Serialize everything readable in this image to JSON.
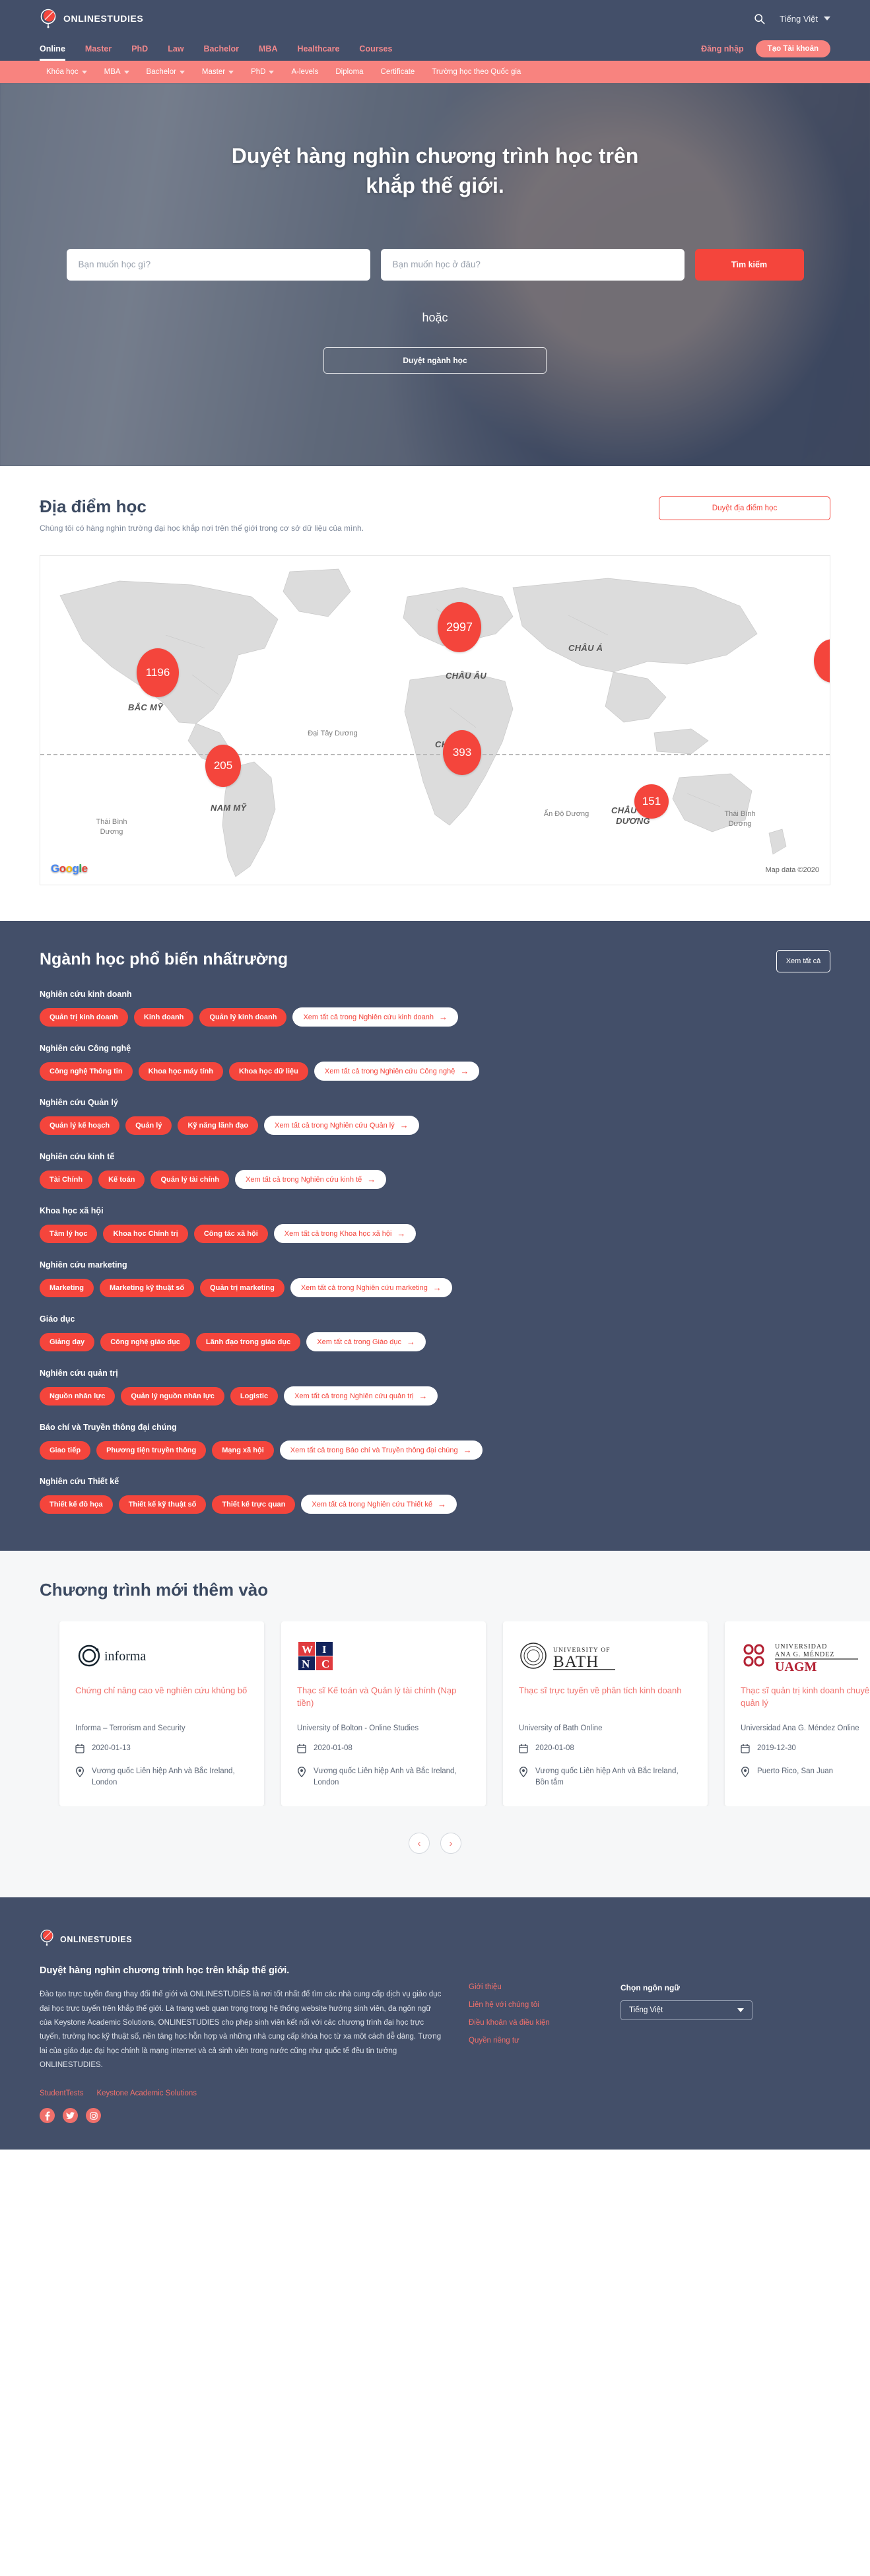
{
  "brand": {
    "name": "ONLINESTUDIES",
    "logo_icon": "globe-logo-icon"
  },
  "header": {
    "search_icon": "search-icon",
    "language": "Tiếng Việt",
    "caret_icon": "chevron-down-icon"
  },
  "nav_primary": {
    "items": [
      {
        "label": "Online",
        "active": true
      },
      {
        "label": "Master",
        "active": false
      },
      {
        "label": "PhD",
        "active": false
      },
      {
        "label": "Law",
        "active": false
      },
      {
        "label": "Bachelor",
        "active": false
      },
      {
        "label": "MBA",
        "active": false
      },
      {
        "label": "Healthcare",
        "active": false
      },
      {
        "label": "Courses",
        "active": false
      }
    ],
    "login_label": "Đăng nhập",
    "signup_label": "Tạo Tài khoản"
  },
  "nav_secondary": {
    "items": [
      {
        "label": "Khóa học",
        "dropdown": true
      },
      {
        "label": "MBA",
        "dropdown": true
      },
      {
        "label": "Bachelor",
        "dropdown": true
      },
      {
        "label": "Master",
        "dropdown": true
      },
      {
        "label": "PhD",
        "dropdown": true
      },
      {
        "label": "A-levels",
        "dropdown": false
      },
      {
        "label": "Diploma",
        "dropdown": false
      },
      {
        "label": "Certificate",
        "dropdown": false
      },
      {
        "label": "Trường học theo Quốc gia",
        "dropdown": false
      }
    ]
  },
  "hero": {
    "title": "Duyệt hàng nghìn chương trình học trên khắp thế giới.",
    "what_placeholder": "Bạn muốn học gì?",
    "what_value": "",
    "where_placeholder": "Bạn muốn học ở đâu?",
    "where_value": "",
    "search_label": "Tìm kiếm",
    "or_label": "hoặc",
    "browse_label": "Duyệt ngành học"
  },
  "locations": {
    "title": "Địa điểm học",
    "subtitle": "Chúng tôi có hàng nghìn trường đại học khắp nơi trên thế giới trong cơ sở dữ liệu của mình.",
    "button_label": "Duyệt địa điểm học",
    "map_credit": "Map data ©2020",
    "map_logo": "Google",
    "markers": [
      {
        "value": "1196",
        "region": "BẮC MỸ"
      },
      {
        "value": "2997",
        "region": "CHÂU ÂU"
      },
      {
        "value": "393",
        "region": "CHÂU PHI"
      },
      {
        "value": "205",
        "region": "NAM MỸ"
      },
      {
        "value": "151",
        "region": "CHÂU ĐẠI DƯƠNG"
      }
    ],
    "continent_labels": [
      "BẮC MỸ",
      "NAM MỸ",
      "CHÂU ÂU",
      "CHÂU Á",
      "CHÂU PHI",
      "CHÂU ĐẠI DƯƠNG"
    ],
    "ocean_labels": [
      "Đại Tây Dương",
      "Thái Bình Dương",
      "Ấn Độ Dương",
      "Thái Bình Dương"
    ]
  },
  "fields": {
    "title": "Ngành học phổ biến nhấtrường",
    "view_all_label": "Xem tất cả",
    "groups": [
      {
        "label": "Nghiên cứu kinh doanh",
        "chips": [
          "Quản trị kinh doanh",
          "Kinh doanh",
          "Quản lý kinh doanh"
        ],
        "all_label": "Xem tất cả trong Nghiên cứu kinh doanh"
      },
      {
        "label": "Nghiên cứu Công nghệ",
        "chips": [
          "Công nghệ Thông tin",
          "Khoa học máy tính",
          "Khoa học dữ liệu"
        ],
        "all_label": "Xem tất cả trong Nghiên cứu Công nghệ"
      },
      {
        "label": "Nghiên cứu Quản lý",
        "chips": [
          "Quản lý kế hoạch",
          "Quản lý",
          "Kỹ năng lãnh đạo"
        ],
        "all_label": "Xem tất cả trong Nghiên cứu Quản lý"
      },
      {
        "label": "Nghiên cứu kinh tế",
        "chips": [
          "Tài Chính",
          "Kế toán",
          "Quản lý tài chính"
        ],
        "all_label": "Xem tất cả trong Nghiên cứu kinh tế"
      },
      {
        "label": "Khoa học xã hội",
        "chips": [
          "Tâm lý học",
          "Khoa học Chính trị",
          "Công tác xã hội"
        ],
        "all_label": "Xem tất cả trong Khoa học xã hội"
      },
      {
        "label": "Nghiên cứu marketing",
        "chips": [
          "Marketing",
          "Marketing kỹ thuật số",
          "Quản trị marketing"
        ],
        "all_label": "Xem tất cả trong Nghiên cứu marketing"
      },
      {
        "label": "Giáo dục",
        "chips": [
          "Giảng dạy",
          "Công nghệ giáo dục",
          "Lãnh đạo trong giáo dục"
        ],
        "all_label": "Xem tất cả trong Giáo dục"
      },
      {
        "label": "Nghiên cứu quản trị",
        "chips": [
          "Nguồn nhân lực",
          "Quản lý nguồn nhân lực",
          "Logistic"
        ],
        "all_label": "Xem tất cả trong Nghiên cứu quản trị"
      },
      {
        "label": "Báo chí và Truyền thông đại chúng",
        "chips": [
          "Giao tiếp",
          "Phương tiện truyền thông",
          "Mạng xã hội"
        ],
        "all_label": "Xem tất cả trong Báo chí và Truyền thông đại chúng"
      },
      {
        "label": "Nghiên cứu Thiết kế",
        "chips": [
          "Thiết kế đồ họa",
          "Thiết kế kỹ thuật số",
          "Thiết kế trực quan"
        ],
        "all_label": "Xem tất cả trong Nghiên cứu Thiết kế"
      }
    ]
  },
  "programs": {
    "title": "Chương trình mới thêm vào",
    "date_icon": "calendar-icon",
    "location_icon": "map-pin-icon",
    "prev_icon": "chevron-left-icon",
    "next_icon": "chevron-right-icon",
    "cards": [
      {
        "logo_text": "informa",
        "logo_kind": "informa-logo",
        "title": "Chứng chỉ nâng cao về nghiên cứu khủng bố",
        "school": "Informa – Terrorism and Security",
        "date": "2020-01-13",
        "location": "Vương quốc Liên hiệp Anh và Bắc Ireland, London"
      },
      {
        "logo_text": "WINC",
        "logo_kind": "winc-logo",
        "title": "Thạc sĩ Kế toán và Quản lý tài chính (Nạp tiền)",
        "school": "University of Bolton - Online Studies",
        "date": "2020-01-08",
        "location": "Vương quốc Liên hiệp Anh và Bắc Ireland, London"
      },
      {
        "logo_text": "UNIVERSITY OF BATH",
        "logo_kind": "bath-logo",
        "title": "Thạc sĩ trực tuyến về phân tích kinh doanh",
        "school": "University of Bath Online",
        "date": "2020-01-08",
        "location": "Vương quốc Liên hiệp Anh và Bắc Ireland, Bồn tắm"
      },
      {
        "logo_text": "UNIVERSIDAD ANA G. MÉNDEZ UAGM",
        "logo_kind": "uagm-logo",
        "title": "Thạc sĩ quản trị kinh doanh chuyên ngành quản lý",
        "school": "Universidad Ana G. Méndez Online",
        "date": "2019-12-30",
        "location": "Puerto Rico, San Juan"
      }
    ]
  },
  "footer": {
    "brand": "ONLINESTUDIES",
    "tagline": "Duyệt hàng nghìn chương trình học trên khắp thế giới.",
    "body": "Đào tạo trực tuyến đang thay đổi thế giới và ONLINESTUDIES là nơi tốt nhất để tìm các nhà cung cấp dịch vụ giáo dục đại học trực tuyến trên khắp thế giới. Là trang web quan trọng trong hệ thống website hướng sinh viên, đa ngôn ngữ của Keystone Academic Solutions, ONLINESTUDIES cho phép sinh viên kết nối với các chương trình đại học trực tuyến, trường học kỹ thuật số, nền tảng học hỗn hợp và những nhà cung cấp khóa học từ xa một cách dễ dàng. Tương lai của giáo dục đại học chính là mạng internet và cả sinh viên trong nước cũng như quốc tế đều tin tưởng ONLINESTUDIES.",
    "partners": [
      "StudentTests",
      "Keystone Academic Solutions"
    ],
    "socials": [
      "facebook-icon",
      "twitter-icon",
      "instagram-icon"
    ],
    "links": [
      "Giới thiệu",
      "Liên hệ với chúng tôi",
      "Điều khoản và điều kiện",
      "Quyền riêng tư"
    ],
    "lang_label": "Chọn ngôn ngữ",
    "lang_value": "Tiếng Việt"
  },
  "colors": {
    "navy": "#434f69",
    "coral": "#f8837f",
    "red": "#f4453c",
    "card_title": "#f0706b"
  }
}
